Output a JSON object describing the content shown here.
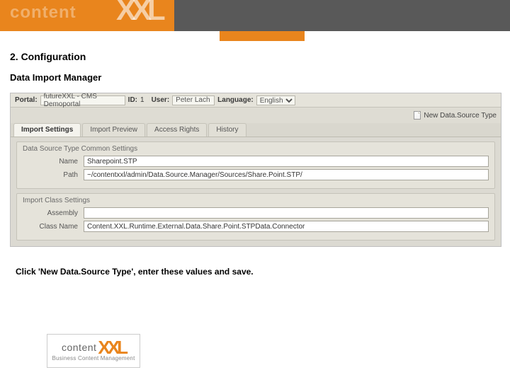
{
  "brand": {
    "name": "content",
    "suffix": "XXL",
    "tagline": "Business Content Management"
  },
  "section_title": "2. Configuration",
  "sub_title": "Data Import Manager",
  "header": {
    "portal_label": "Portal:",
    "portal_value": "futureXXL - CMS Demoportal",
    "id_label": "ID:",
    "id_value": "1",
    "user_label": "User:",
    "user_value": "Peter Lach",
    "language_label": "Language:",
    "language_value": "English"
  },
  "toolbar": {
    "new_label": "New Data.Source Type"
  },
  "tabs": [
    {
      "label": "Import Settings",
      "active": true
    },
    {
      "label": "Import Preview",
      "active": false
    },
    {
      "label": "Access Rights",
      "active": false
    },
    {
      "label": "History",
      "active": false
    }
  ],
  "groups": [
    {
      "title": "Data Source Type Common Settings",
      "fields": [
        {
          "label": "Name",
          "value": "Sharepoint.STP"
        },
        {
          "label": "Path",
          "value": "~/contentxxl/admin/Data.Source.Manager/Sources/Share.Point.STP/"
        }
      ]
    },
    {
      "title": "Import Class Settings",
      "fields": [
        {
          "label": "Assembly",
          "value": ""
        },
        {
          "label": "Class Name",
          "value": "Content.XXL.Runtime.External.Data.Share.Point.STPData.Connector"
        }
      ]
    }
  ],
  "instruction": "Click 'New Data.Source Type', enter these values and save."
}
